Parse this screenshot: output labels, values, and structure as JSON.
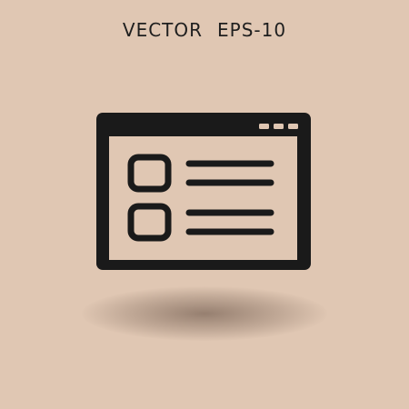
{
  "caption": {
    "word1": "VECTOR",
    "word2": "EPS-10"
  },
  "icon": {
    "name": "browser-window-list-icon",
    "color": "#1a1a1a"
  },
  "colors": {
    "background": "#e0c7b3",
    "icon_fill": "#e0c7b3"
  }
}
